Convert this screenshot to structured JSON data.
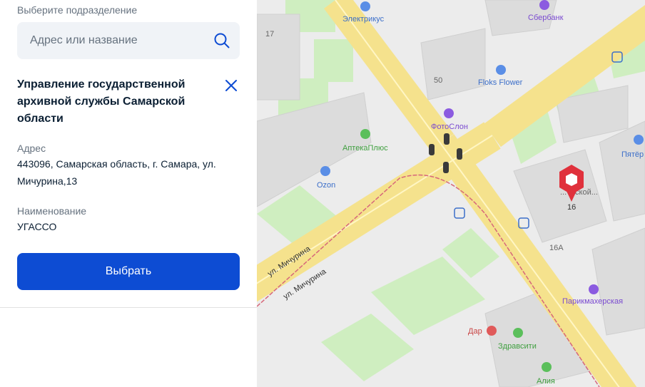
{
  "panel": {
    "section_label": "Выберите подразделение",
    "search": {
      "placeholder": "Адрес или название",
      "value": ""
    },
    "selected": {
      "title": "Управление государственной архивной службы Самарской области",
      "address_label": "Адрес",
      "address_value": "443096, Самарская область, г. Самара, ул. Мичурина,13",
      "name_label": "Наименование",
      "name_value": "УГАССО"
    },
    "select_button": "Выбрать",
    "colors": {
      "accent": "#0d4cd3",
      "text": "#0b1f33",
      "muted": "#66727f"
    }
  },
  "map": {
    "streets": [
      "ул. Мичурина",
      "ул. Мичурина"
    ],
    "house_numbers": [
      "17",
      "50",
      "16",
      "16А"
    ],
    "pois": [
      {
        "name": "Электрикус",
        "icon": "shopping-bag-icon"
      },
      {
        "name": "Сбербанк",
        "icon": "bank-icon"
      },
      {
        "name": "Floks Flower",
        "icon": "flower-icon"
      },
      {
        "name": "ФотоСлон",
        "icon": "camera-icon"
      },
      {
        "name": "АптекаПлюс",
        "icon": "pharmacy-icon"
      },
      {
        "name": "Ozon",
        "icon": "shopping-bag-icon"
      },
      {
        "name": "Пятёр",
        "icon": "shopping-bag-icon"
      },
      {
        "name": "Парикмахерская",
        "icon": "scissors-icon"
      },
      {
        "name": "Дар",
        "icon": "pharmacy-icon"
      },
      {
        "name": "Здравсити",
        "icon": "pharmacy-icon"
      },
      {
        "name": "Алия",
        "icon": "pharmacy-icon"
      }
    ],
    "building_label_fragments": [
      "...",
      "...ческой..."
    ],
    "marker_icon": "location-pin-icon"
  }
}
